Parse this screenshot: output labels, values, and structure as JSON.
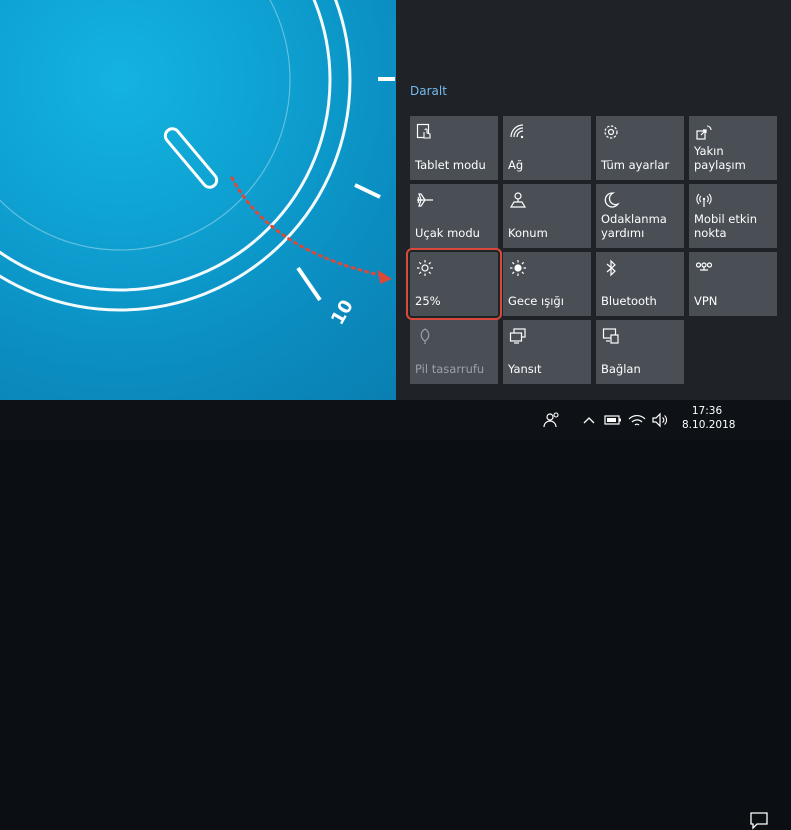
{
  "wallpaper": {
    "dial_number": "10"
  },
  "action_center": {
    "collapse_label": "Daralt",
    "tiles": [
      {
        "label": "Tablet modu",
        "icon": "tablet-mode-icon"
      },
      {
        "label": "Ağ",
        "icon": "network-icon"
      },
      {
        "label": "Tüm ayarlar",
        "icon": "gear-icon"
      },
      {
        "label": "Yakın paylaşım",
        "icon": "nearby-share-icon"
      },
      {
        "label": "Uçak modu",
        "icon": "airplane-icon"
      },
      {
        "label": "Konum",
        "icon": "location-icon"
      },
      {
        "label": "Odaklanma yardımı",
        "icon": "moon-icon"
      },
      {
        "label": "Mobil etkin nokta",
        "icon": "hotspot-icon"
      },
      {
        "label": "25%",
        "icon": "brightness-icon"
      },
      {
        "label": "Gece ışığı",
        "icon": "night-light-icon"
      },
      {
        "label": "Bluetooth",
        "icon": "bluetooth-icon"
      },
      {
        "label": "VPN",
        "icon": "vpn-icon"
      },
      {
        "label": "Pil tasarrufu",
        "icon": "battery-saver-icon"
      },
      {
        "label": "Yansıt",
        "icon": "project-icon"
      },
      {
        "label": "Bağlan",
        "icon": "connect-icon"
      }
    ],
    "highlighted_tile": "25%"
  },
  "taskbar": {
    "time": "17:36",
    "date": "8.10.2018"
  },
  "colors": {
    "panel_bg": "#1f2327",
    "tile_bg": "#4a4f55",
    "link": "#76b9ed",
    "highlight": "#d94a3b",
    "wallpaper": "#0ea2d2"
  }
}
